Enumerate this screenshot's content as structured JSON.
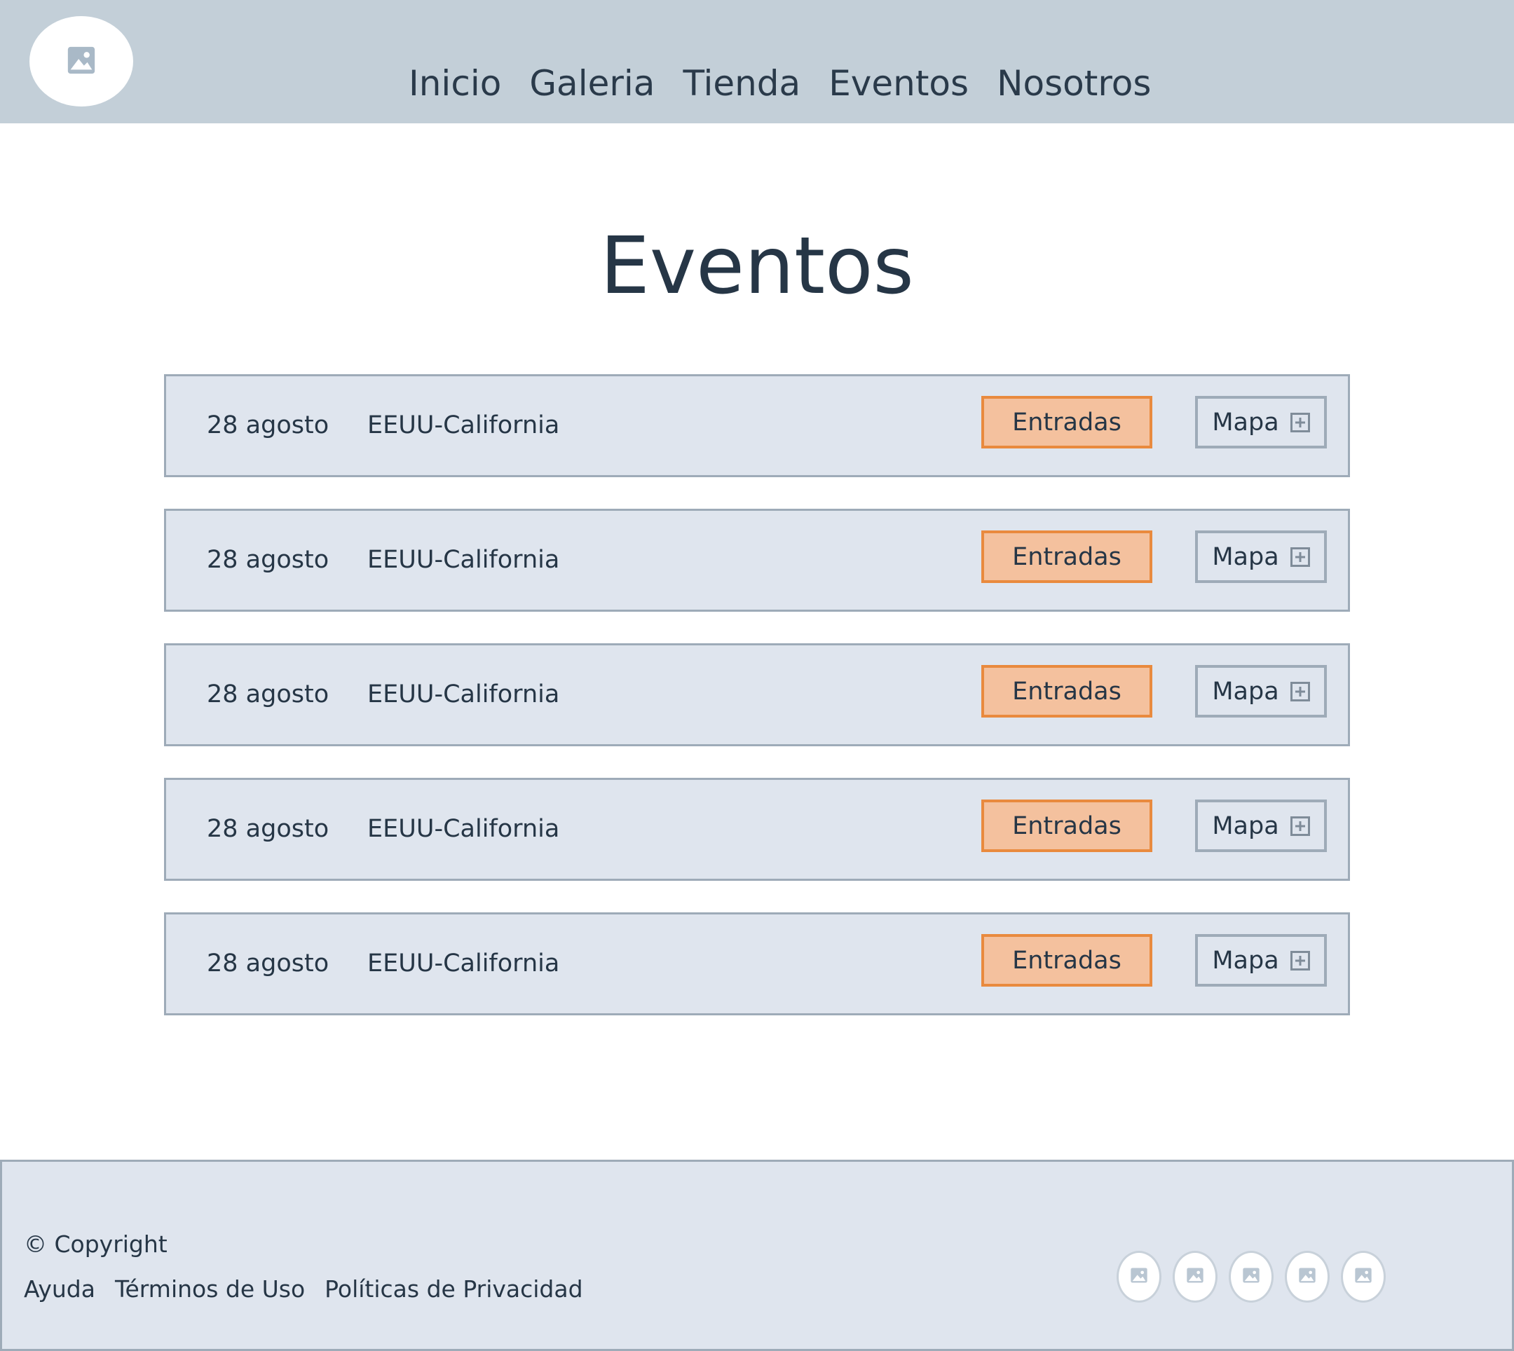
{
  "header": {
    "logo_icon": "image-placeholder-icon",
    "nav": [
      {
        "label": "Inicio"
      },
      {
        "label": "Galeria"
      },
      {
        "label": "Tienda"
      },
      {
        "label": "Eventos"
      },
      {
        "label": "Nosotros"
      }
    ]
  },
  "main": {
    "title": "Eventos",
    "events": [
      {
        "date": "28 agosto",
        "location": "EEUU-California",
        "tickets_label": "Entradas",
        "map_label": "Mapa"
      },
      {
        "date": "28 agosto",
        "location": "EEUU-California",
        "tickets_label": "Entradas",
        "map_label": "Mapa"
      },
      {
        "date": "28 agosto",
        "location": "EEUU-California",
        "tickets_label": "Entradas",
        "map_label": "Mapa"
      },
      {
        "date": "28 agosto",
        "location": "EEUU-California",
        "tickets_label": "Entradas",
        "map_label": "Mapa"
      },
      {
        "date": "28 agosto",
        "location": "EEUU-California",
        "tickets_label": "Entradas",
        "map_label": "Mapa"
      }
    ]
  },
  "footer": {
    "copyright": "© Copyright",
    "links": [
      {
        "label": "Ayuda"
      },
      {
        "label": "Términos de Uso"
      },
      {
        "label": "Políticas de Privacidad"
      }
    ],
    "social_icons": [
      "image-placeholder-icon",
      "image-placeholder-icon",
      "image-placeholder-icon",
      "image-placeholder-icon",
      "image-placeholder-icon"
    ]
  },
  "colors": {
    "header_bg": "#c3cfd8",
    "row_bg": "#dfe5ee",
    "row_border": "#9eabb8",
    "tickets_bg": "#f4c19e",
    "tickets_border": "#e98a3e",
    "text": "#263646"
  }
}
